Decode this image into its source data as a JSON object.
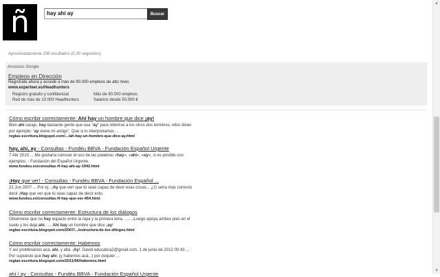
{
  "logo": {
    "glyph": "ñ"
  },
  "search": {
    "value": "hay ahí ay",
    "button_label": "Buscar"
  },
  "stats": "Aproximadamente 206 resultados (0,30 segundos)",
  "ads": {
    "label": "Anuncios Google",
    "title": "Empleos en Dirección",
    "desc": "Regístrate ahora y accede a más de 90.000 empleos de alto nivel.",
    "url": "www.experteer.es/Headhunters",
    "col1": [
      "Registro gratuito y confidencial",
      "Red de más de 10.000 Headhunters"
    ],
    "col2": [
      "Más de 90.000 empleos",
      "Salarios desde 50.000 €"
    ]
  },
  "results": [
    {
      "title_html": "Cómo escribir correctamente: <b>Ahí hay</b> un hombre que dice <b>¡ay!</b>",
      "snippet_html": "Bien <b>ahí</b> carajo, <b>hay</b> bastante gente que usa \"<b>ay</b>\" para referirse a los otros dos terminos, ellos dicen por ejemplo: \"<b>ay</b> viene mi amigo\". Que si lo interpretamos ...",
      "url": "reglas-escritura.blogspot.com/.../ah-hay-un-hombre-que-dice-ay.html"
    },
    {
      "title_html": "<b>hay, ahí, ay</b> - Consultas - Fundéu BBVA - Fundación Español Urgente",
      "snippet_html": "7 Abr 2010 ... Me gustaría conocer el uso de las palabras «<b>hay</b>», «<b>ahí</b>», «<b>ay</b>», si es posible con ejemplos. - Fundación del Español Urgente.",
      "url": "www.fundeu.es/consultas-H-hay-ahi-ay-1942.html"
    },
    {
      "title_html": "¡<b>Hay</b> que ver! - Consultas - Fundéu BBVA - Fundación Español ...",
      "snippet_html": "22 Jun 2007 ... Por ej.: ¡<b>Ay</b> que ver! que tú seas capaz de decir esas cosas... ¿O sería más correcto decir ¡<b>Hay</b> que ver que tú seas capaz de decir esto.",
      "url": "www.fundeu.es/consultas-H-hay-que-ver-454.html"
    },
    {
      "title_html": "Cómo escribir correctamente: Estructura de los diálogos",
      "snippet_html": "Obsérvese que no <b>hay</b> espacio entre la raya y la primera letra. ...... ¡Luego apoya ambos pies en el suelo y los deja <b>ahí</b>. .... <b>Ahí hay</b> un hombre que dice ¡<b>ay</b>!",
      "url": "reglas-escritura.blogspot.com/2007/.../estructura-de-los-dilogos.html"
    },
    {
      "title_html": "Cómo escribir correctamente: Habemos",
      "snippet_html": "Y así proliferamos acá, <b>ahí</b>, y allá. ¡<b>Ay</b>!. David educatica2@gmail.com. 1 de junio de 2012 00:43 ... Por supuesto que <b>hay ahí</b>, (y habemos acá...) por doquier ...",
      "url": "reglas-escritura.blogspot.com/2011/06/habemos.html"
    },
    {
      "title_html": "ahí / ay - Consultas - Fundéu BBVA - Fundación Español Urgente",
      "snippet_html": "",
      "url": ""
    }
  ]
}
